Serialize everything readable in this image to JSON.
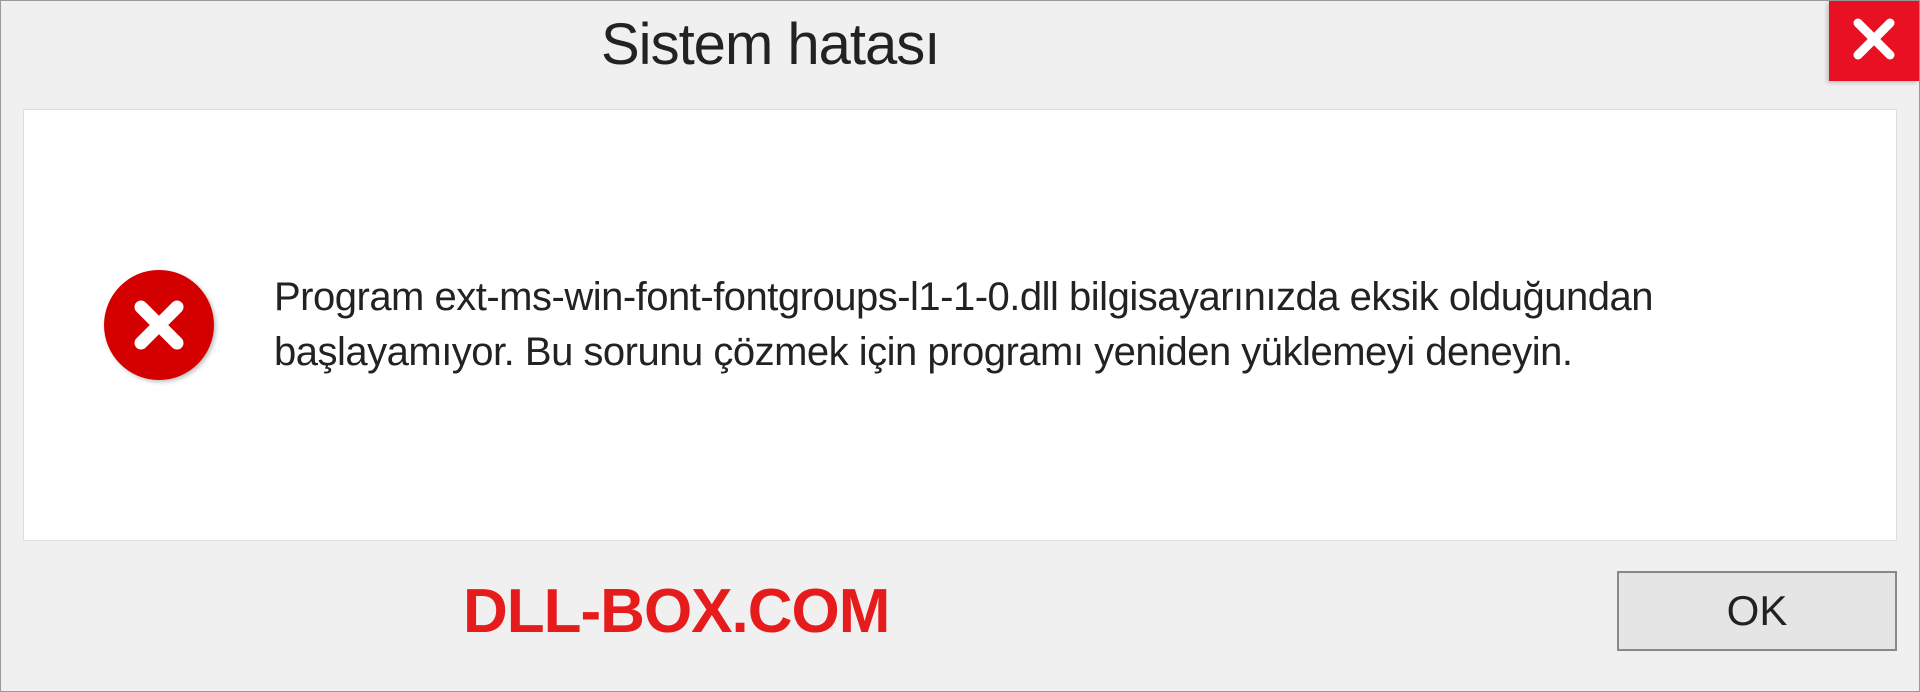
{
  "titlebar": {
    "title": "Sistem hatası"
  },
  "content": {
    "message": "Program ext-ms-win-font-fontgroups-l1-1-0.dll bilgisayarınızda eksik olduğundan başlayamıyor. Bu sorunu çözmek için programı yeniden yüklemeyi deneyin."
  },
  "footer": {
    "watermark": "DLL-BOX.COM",
    "ok_label": "OK"
  },
  "icons": {
    "close": "close-icon",
    "error": "error-icon"
  },
  "colors": {
    "close_bg": "#e81123",
    "error_bg": "#d40000",
    "watermark": "#e61c1c"
  }
}
